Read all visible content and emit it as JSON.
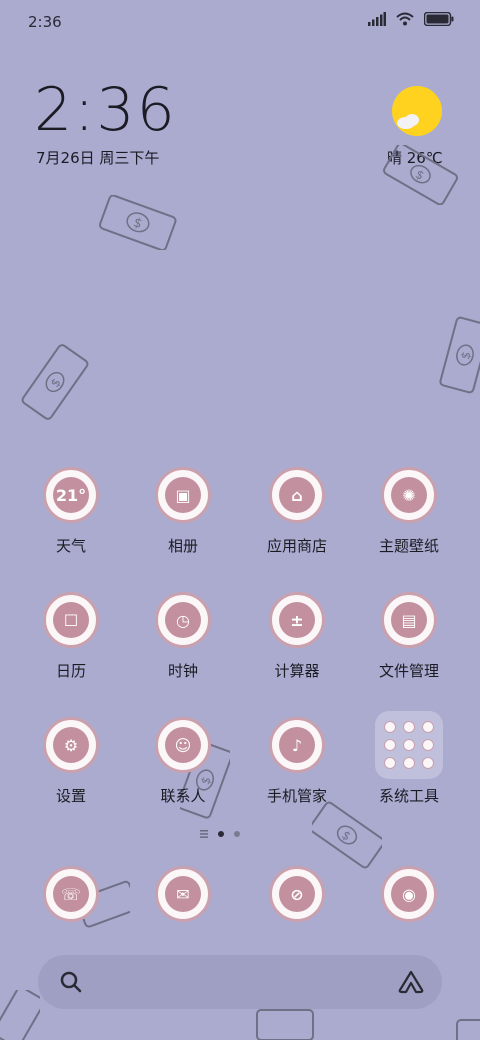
{
  "status_bar": {
    "time": "2:36",
    "icons": [
      "signal-icon",
      "wifi-icon",
      "battery-icon"
    ]
  },
  "clock_widget": {
    "time": "2:36",
    "date": "7月26日 周三下午"
  },
  "weather_widget": {
    "text": "晴 26℃",
    "icon": "sun-cloud-icon"
  },
  "apps": [
    {
      "label": "天气",
      "glyph": "21°"
    },
    {
      "label": "相册",
      "glyph": "▣"
    },
    {
      "label": "应用商店",
      "glyph": "⌂"
    },
    {
      "label": "主题壁纸",
      "glyph": "✺"
    },
    {
      "label": "日历",
      "glyph": "☐"
    },
    {
      "label": "时钟",
      "glyph": "◷"
    },
    {
      "label": "计算器",
      "glyph": "±"
    },
    {
      "label": "文件管理",
      "glyph": "▤"
    },
    {
      "label": "设置",
      "glyph": "⚙"
    },
    {
      "label": "联系人",
      "glyph": "☺"
    },
    {
      "label": "手机管家",
      "glyph": "♪"
    },
    {
      "label": "系统工具",
      "glyph": ""
    }
  ],
  "dock": [
    {
      "name": "phone",
      "glyph": "☏"
    },
    {
      "name": "messages",
      "glyph": "✉"
    },
    {
      "name": "browser",
      "glyph": "⊘"
    },
    {
      "name": "camera",
      "glyph": "◉"
    }
  ],
  "page_indicator": {
    "pages": 2,
    "current": 1
  },
  "search": {
    "icon": "search-icon",
    "assistant_icon": "assistant-icon"
  },
  "colors": {
    "background": "#ABABD0",
    "icon_pink": "#c2909f",
    "icon_ring": "#c9a0ad"
  }
}
